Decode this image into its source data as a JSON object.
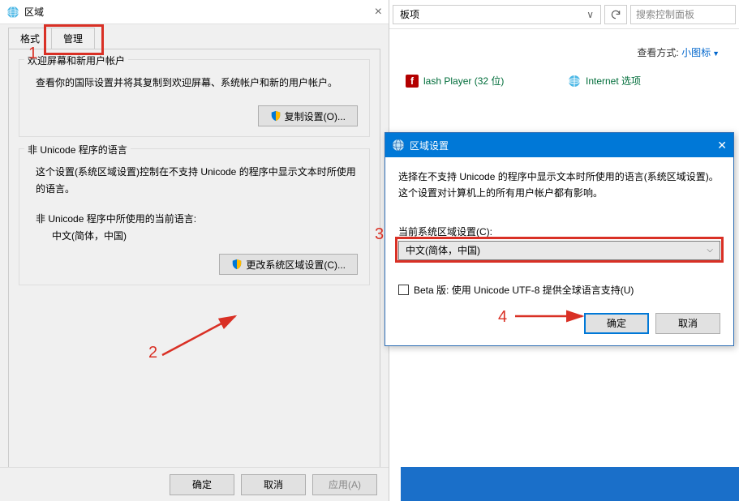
{
  "region_dialog": {
    "title": "区域",
    "close": "×",
    "tabs": {
      "format": "格式",
      "manage": "管理"
    },
    "welcome_group": {
      "title": "欢迎屏幕和新用户帐户",
      "desc": "查看你的国际设置并将其复制到欢迎屏幕、系统帐户和新的用户帐户。",
      "button": "复制设置(O)..."
    },
    "unicode_group": {
      "title": "非 Unicode 程序的语言",
      "desc": "这个设置(系统区域设置)控制在不支持 Unicode 的程序中显示文本时所使用的语言。",
      "current_label": "非 Unicode 程序中所使用的当前语言:",
      "current_value": "中文(简体，中国)",
      "button": "更改系统区域设置(C)..."
    },
    "buttons": {
      "ok": "确定",
      "cancel": "取消",
      "apply": "应用(A)"
    }
  },
  "control_panel": {
    "breadcrumb": "板项",
    "breadcrumb_chev": "∨",
    "search_placeholder": "搜索控制面板",
    "viewby_label": "查看方式:",
    "viewby_value": "小图标",
    "items_col1": [
      "lash Player (32 位)"
    ],
    "items_col2": [
      "Internet 选项"
    ]
  },
  "locale_dialog": {
    "title": "区域设置",
    "close": "✕",
    "desc": "选择在不支持 Unicode 的程序中显示文本时所使用的语言(系统区域设置)。这个设置对计算机上的所有用户帐户都有影响。",
    "dropdown_label": "当前系统区域设置(C):",
    "dropdown_value": "中文(简体，中国)",
    "checkbox_label": "Beta 版: 使用 Unicode UTF-8 提供全球语言支持(U)",
    "ok": "确定",
    "cancel": "取消"
  },
  "annotations": {
    "n1": "1",
    "n2": "2",
    "n3": "3",
    "n4": "4"
  }
}
